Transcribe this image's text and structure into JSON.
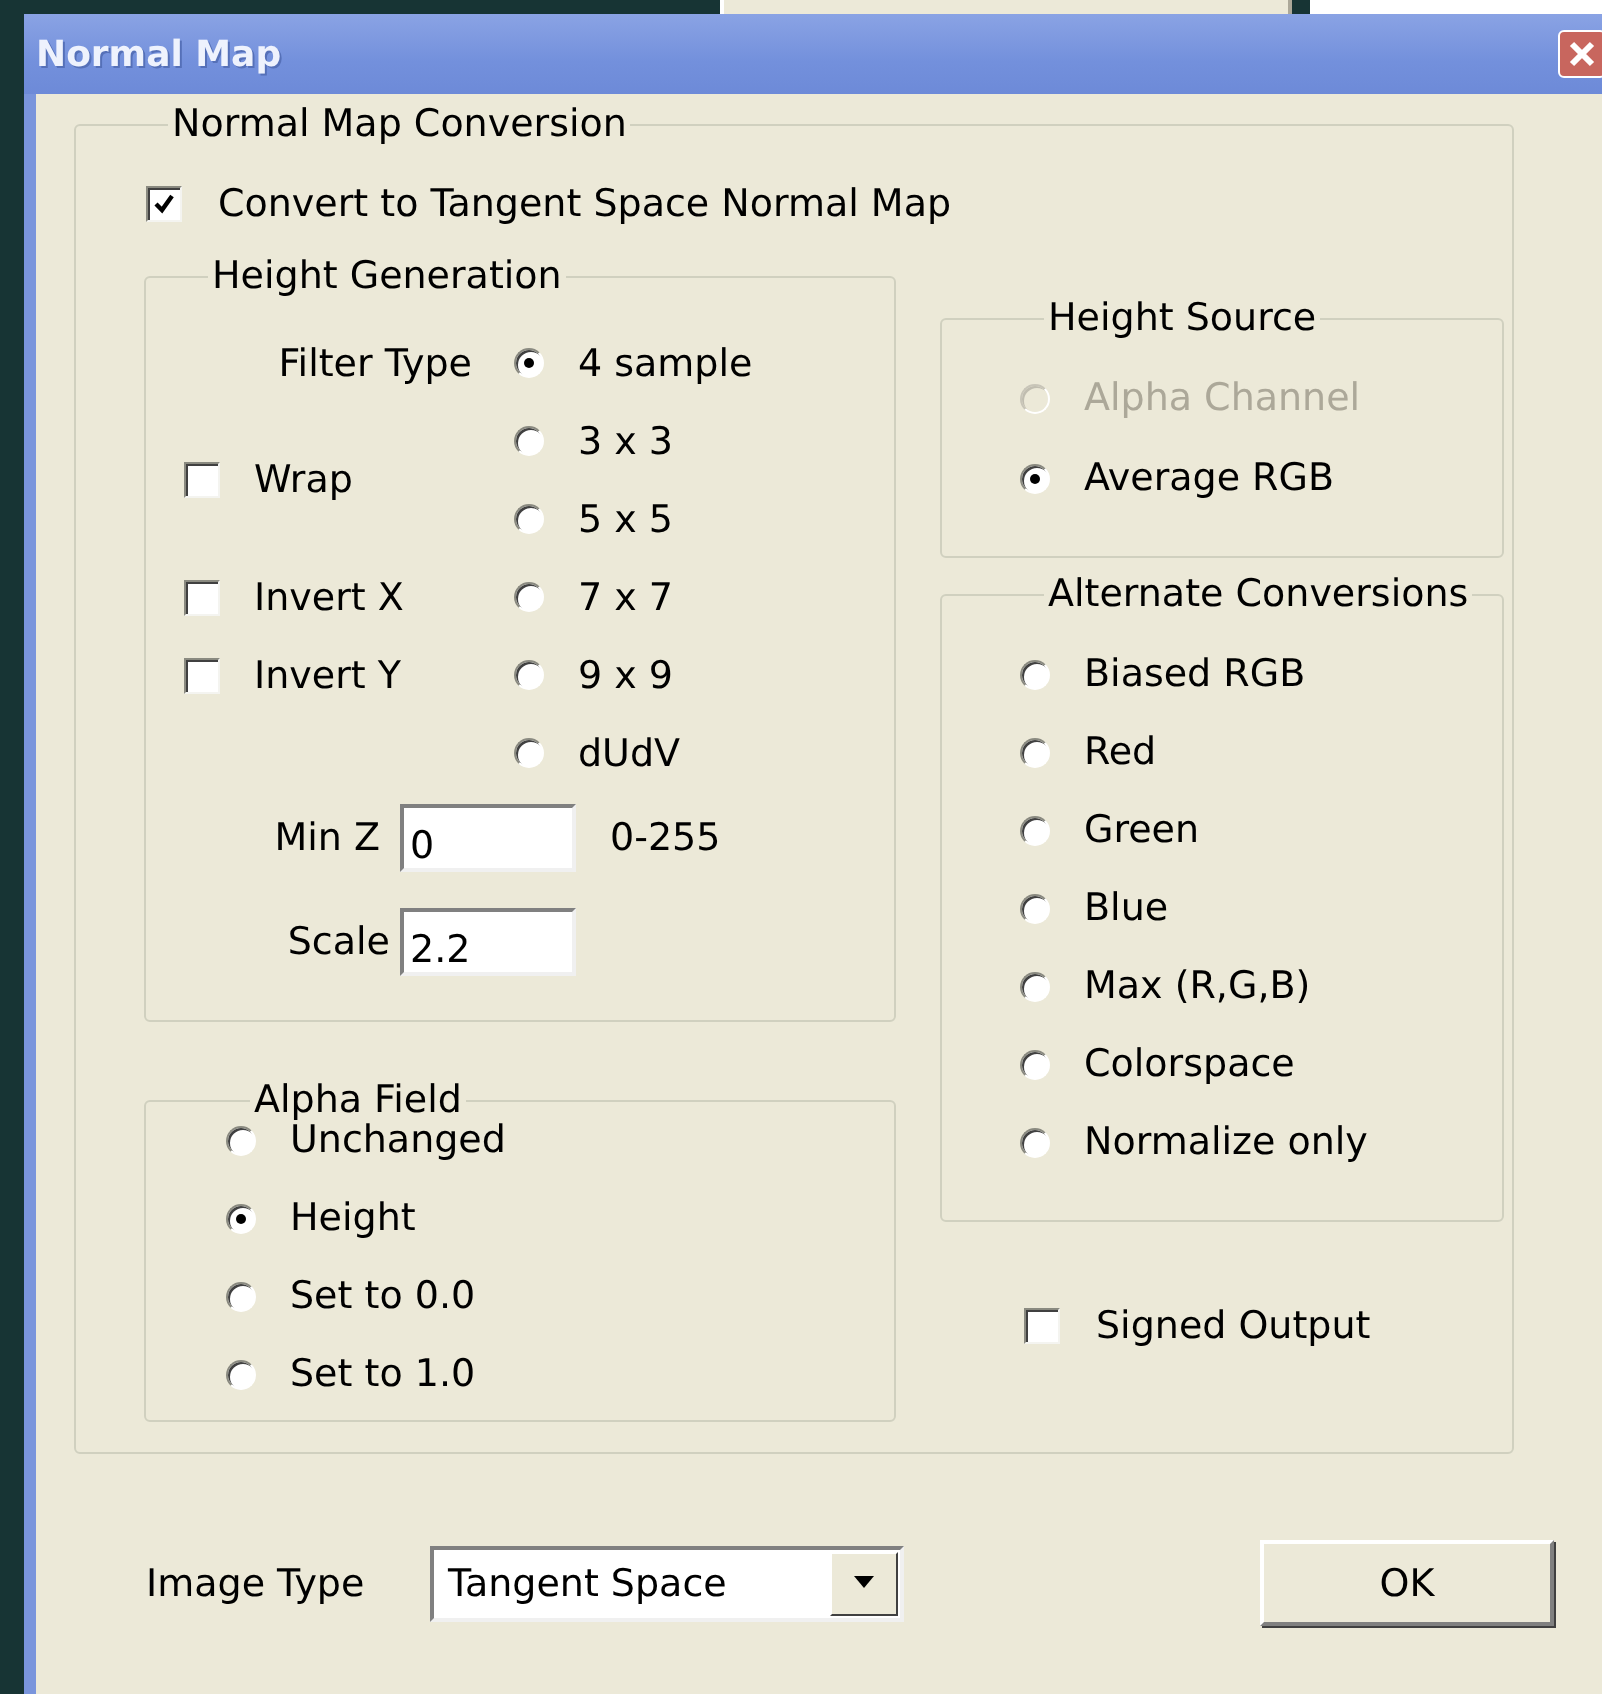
{
  "window": {
    "title": "Normal Map"
  },
  "conversion": {
    "title": "Normal Map Conversion",
    "convert_checkbox": {
      "label": "Convert to Tangent Space Normal Map",
      "checked": true
    },
    "height_generation": {
      "title": "Height Generation",
      "filter_type_label": "Filter Type",
      "filter_types": [
        {
          "label": "4 sample",
          "selected": true
        },
        {
          "label": "3 x 3",
          "selected": false
        },
        {
          "label": "5 x 5",
          "selected": false
        },
        {
          "label": "7 x 7",
          "selected": false
        },
        {
          "label": "9 x 9",
          "selected": false
        },
        {
          "label": "dUdV",
          "selected": false
        }
      ],
      "checkboxes": [
        {
          "label": "Wrap",
          "checked": false
        },
        {
          "label": "Invert X",
          "checked": false
        },
        {
          "label": "Invert Y",
          "checked": false
        }
      ],
      "min_z": {
        "label": "Min Z",
        "value": "0",
        "range": "0-255"
      },
      "scale": {
        "label": "Scale",
        "value": "2.2"
      }
    },
    "alpha_field": {
      "title": "Alpha Field",
      "options": [
        {
          "label": "Unchanged",
          "selected": false
        },
        {
          "label": "Height",
          "selected": true
        },
        {
          "label": "Set to 0.0",
          "selected": false
        },
        {
          "label": "Set to 1.0",
          "selected": false
        }
      ]
    },
    "height_source": {
      "title": "Height Source",
      "options": [
        {
          "label": "Alpha Channel",
          "selected": false,
          "disabled": true
        },
        {
          "label": "Average RGB",
          "selected": true,
          "disabled": false
        }
      ]
    },
    "alternate_conversions": {
      "title": "Alternate Conversions",
      "options": [
        {
          "label": "Biased RGB",
          "selected": false
        },
        {
          "label": "Red",
          "selected": false
        },
        {
          "label": "Green",
          "selected": false
        },
        {
          "label": "Blue",
          "selected": false
        },
        {
          "label": "Max (R,G,B)",
          "selected": false
        },
        {
          "label": "Colorspace",
          "selected": false
        },
        {
          "label": "Normalize only",
          "selected": false
        }
      ]
    },
    "signed_output": {
      "label": "Signed Output",
      "checked": false
    }
  },
  "image_type": {
    "label": "Image Type",
    "value": "Tangent Space"
  },
  "buttons": [
    {
      "label": "OK"
    }
  ]
}
